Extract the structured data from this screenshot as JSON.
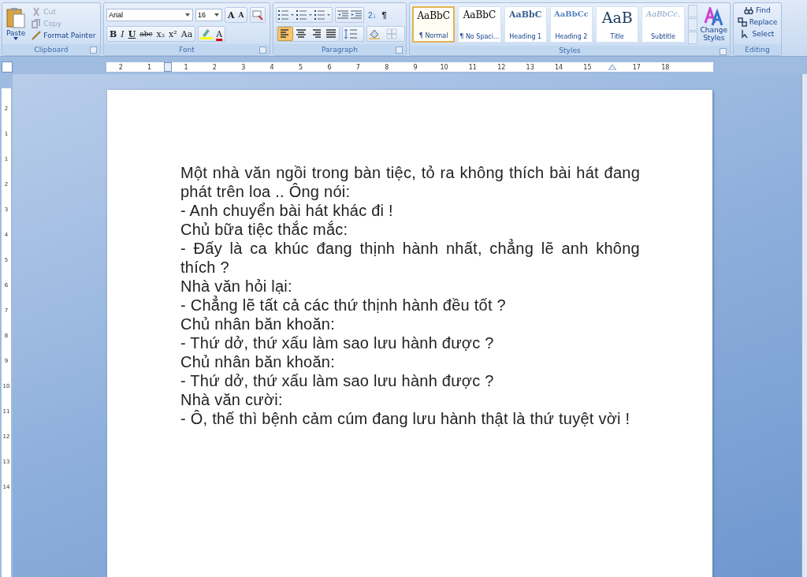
{
  "ribbon": {
    "clipboard": {
      "paste": "Paste",
      "items": [
        {
          "label": "Cut",
          "disabled": true
        },
        {
          "label": "Copy",
          "disabled": true
        },
        {
          "label": "Format Painter",
          "disabled": false
        }
      ],
      "label": "Clipboard"
    },
    "font": {
      "font_name": "Arial",
      "font_size": "16",
      "grow": "A",
      "shrink": "A",
      "buttons": [
        "B",
        "I",
        "U",
        "abc",
        "x₂",
        "x²",
        "Aa"
      ],
      "color_letter": "A",
      "label": "Font"
    },
    "paragraph": {
      "sort": "2↓",
      "pilcrow": "¶",
      "alignments": [
        {
          "selected": true
        },
        {
          "selected": false
        },
        {
          "selected": false
        },
        {
          "selected": false
        }
      ],
      "label": "Paragraph"
    },
    "styles": {
      "items": [
        {
          "kind": "normal",
          "sample": "AaBbC",
          "name": "¶ Normal",
          "selected": true
        },
        {
          "kind": "normal",
          "sample": "AaBbC",
          "name": "¶ No Spaci...",
          "selected": false
        },
        {
          "kind": "heading1",
          "sample": "AaBbC",
          "name": "Heading 1",
          "selected": false
        },
        {
          "kind": "heading2",
          "sample": "AaBbCc",
          "name": "Heading 2",
          "selected": false
        },
        {
          "kind": "title",
          "sample": "AaB",
          "name": "Title",
          "selected": false
        },
        {
          "kind": "subtitle",
          "sample": "AaBbCc.",
          "name": "Subtitle",
          "selected": false
        }
      ],
      "change_styles": [
        "Change",
        "Styles"
      ],
      "label": "Styles"
    },
    "editing": {
      "items": [
        "Find",
        "Replace",
        "Select"
      ],
      "label": "Editing"
    }
  },
  "ruler": {
    "left_numbers": [
      "2",
      "1"
    ],
    "numbers": [
      "1",
      "2",
      "3",
      "4",
      "5",
      "6",
      "7",
      "8",
      "9",
      "10",
      "11",
      "12",
      "13",
      "14",
      "15"
    ],
    "right_numbers": [
      "17",
      "18"
    ]
  },
  "vertical_ruler": {
    "numbers": [
      "2",
      "1",
      "1",
      "2",
      "3",
      "4",
      "5",
      "6",
      "7",
      "8",
      "9",
      "10",
      "11",
      "12",
      "13",
      "14"
    ]
  },
  "document": {
    "paragraphs": [
      "Một nhà văn ngồi trong bàn tiệc, tỏ ra không thích bài hát đang phát trên loa .. Ông nói:",
      "- Anh chuyển bài hát khác đi !",
      "Chủ bữa tiệc thắc mắc:",
      "- Đấy là ca khúc đang thịnh hành nhất, chẳng lẽ anh không thích ?",
      "Nhà văn hỏi lại:",
      "- Chẳng lẽ tất cả các thứ thịnh hành đều tốt ?",
      "Chủ nhân băn khoăn:",
      "- Thứ dở, thứ xấu làm sao lưu hành được ?",
      "Chủ nhân băn khoăn:",
      "- Thứ dở, thứ xấu làm sao lưu hành được ?",
      "Nhà văn cười:",
      "- Ô, thế thì bệnh cảm cúm đang lưu hành thật là thứ tuyệt vời !"
    ]
  }
}
